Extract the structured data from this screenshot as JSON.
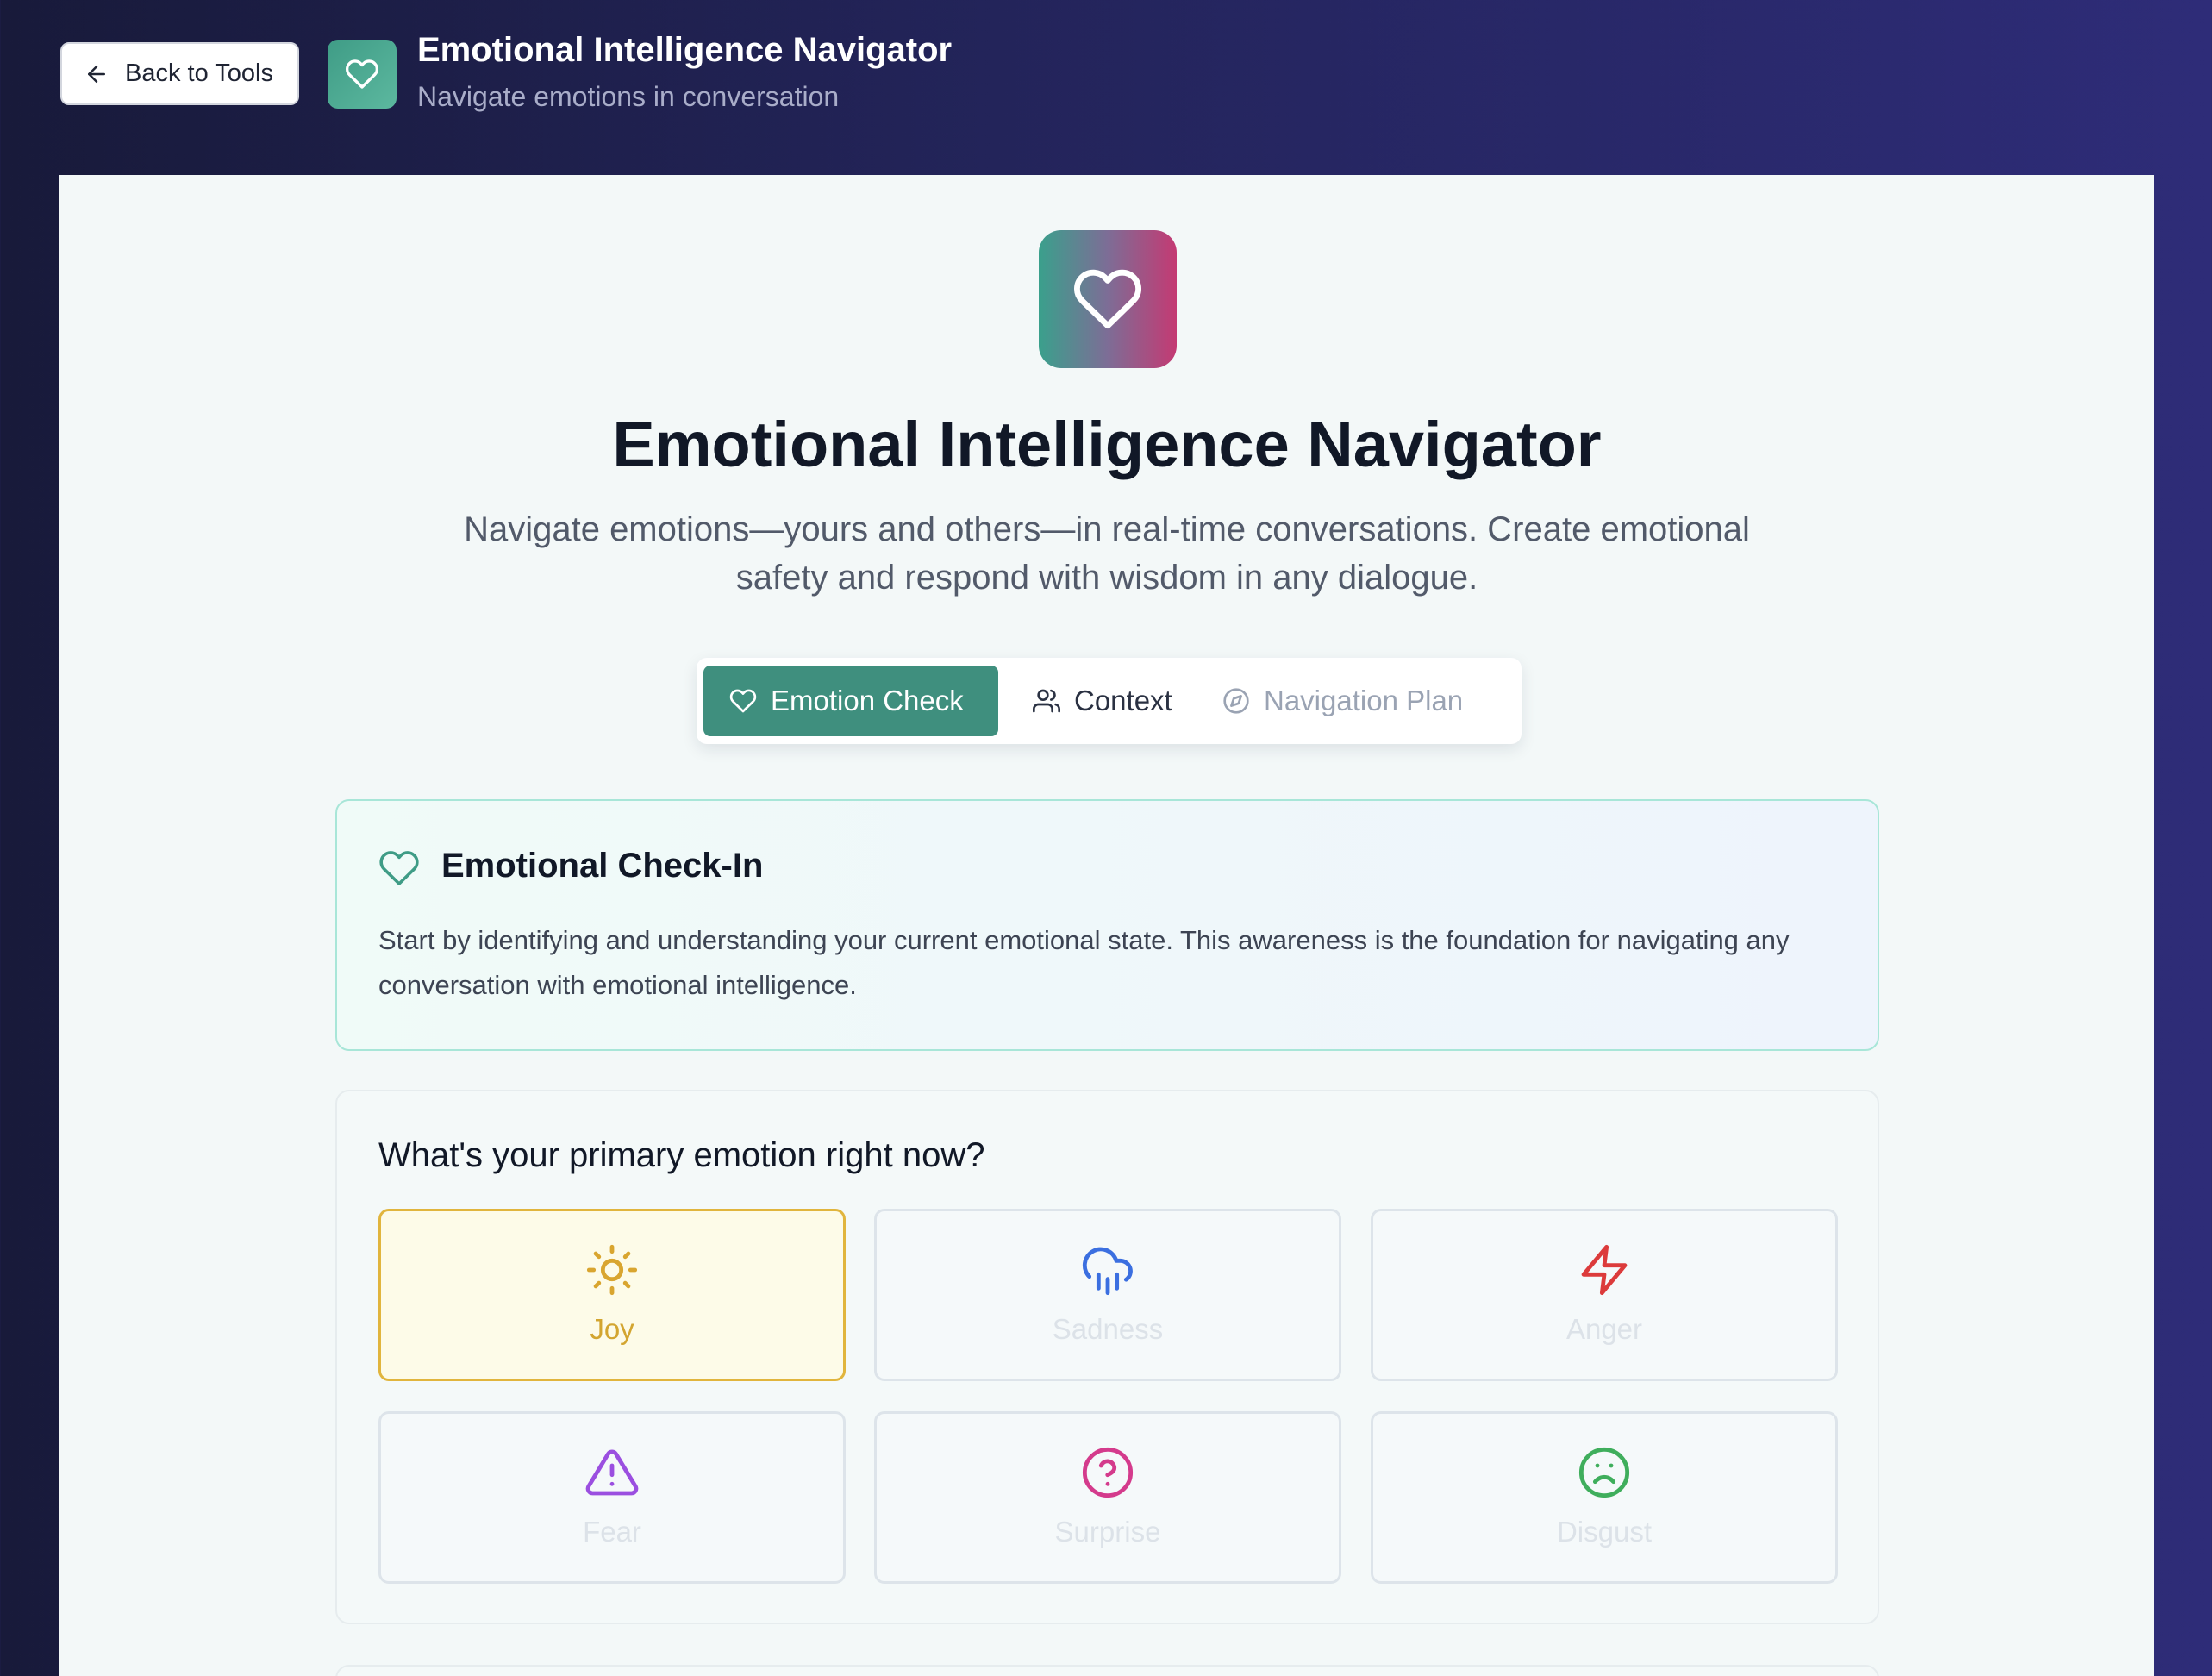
{
  "header": {
    "back_label": "Back to Tools",
    "title": "Emotional Intelligence Navigator",
    "subtitle": "Navigate emotions in conversation"
  },
  "hero": {
    "title": "Emotional Intelligence Navigator",
    "description": "Navigate emotions—yours and others—in real-time conversations. Create emotional safety and respond with wisdom in any dialogue."
  },
  "tabs": [
    {
      "label": "Emotion Check",
      "icon": "heart-icon",
      "active": true
    },
    {
      "label": "Context",
      "icon": "users-icon",
      "active": false
    },
    {
      "label": "Navigation Plan",
      "icon": "compass-icon",
      "active": false
    }
  ],
  "intro": {
    "title": "Emotional Check-In",
    "text": "Start by identifying and understanding your current emotional state. This awareness is the foundation for navigating any conversation with emotional intelligence."
  },
  "emotion_picker": {
    "question": "What's your primary emotion right now?",
    "selected": "Joy",
    "options": [
      {
        "label": "Joy",
        "icon": "sun-icon",
        "color": "#d9a52f"
      },
      {
        "label": "Sadness",
        "icon": "cloud-rain-icon",
        "color": "#3b6fe0"
      },
      {
        "label": "Anger",
        "icon": "zap-icon",
        "color": "#dc3b3b"
      },
      {
        "label": "Fear",
        "icon": "alert-triangle-icon",
        "color": "#9b4fe0"
      },
      {
        "label": "Surprise",
        "icon": "help-circle-icon",
        "color": "#d43b8c"
      },
      {
        "label": "Disgust",
        "icon": "frown-icon",
        "color": "#3fae5c"
      }
    ]
  },
  "colors": {
    "accent": "#3f8f7e",
    "header_bg": "#23245a",
    "panel_bg": "#f3f8f8",
    "selected_border": "#e1b53d"
  }
}
